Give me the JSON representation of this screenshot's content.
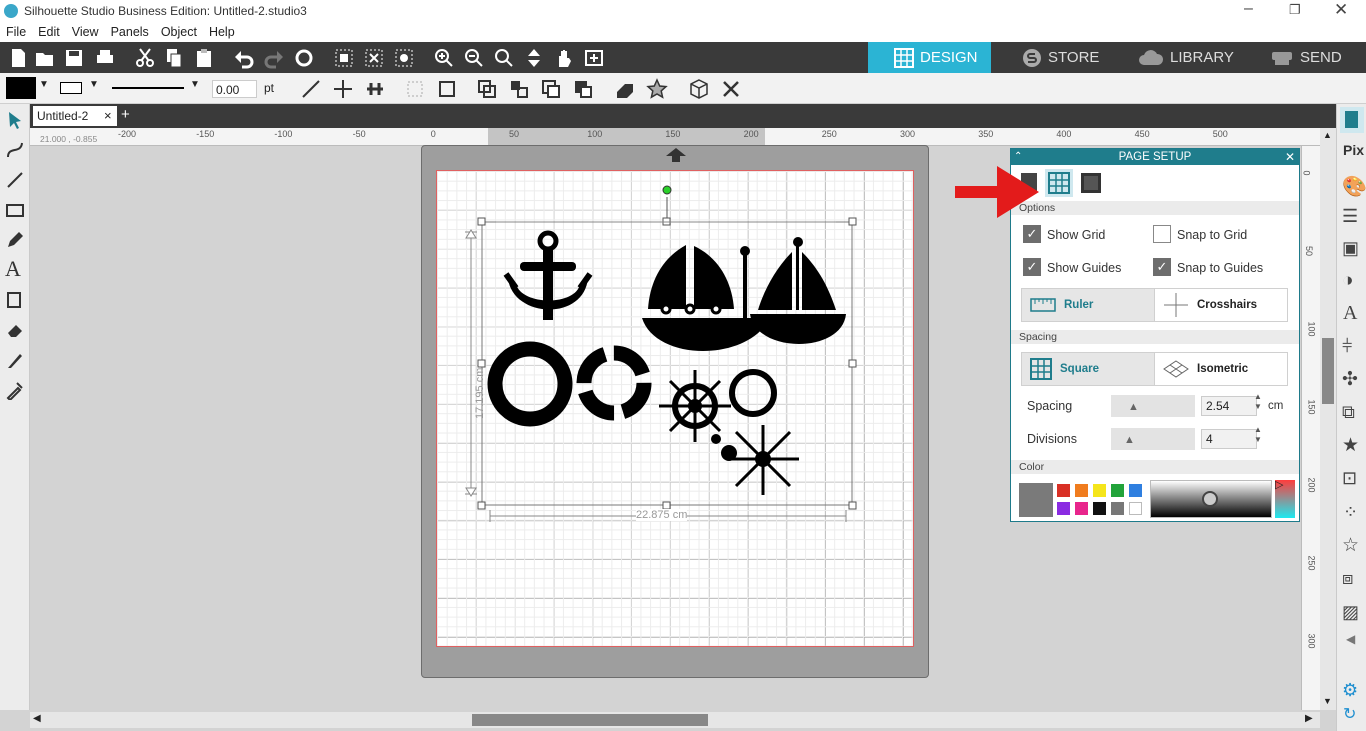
{
  "window": {
    "title": "Silhouette Studio Business Edition: Untitled-2.studio3"
  },
  "menu": [
    "File",
    "Edit",
    "View",
    "Panels",
    "Object",
    "Help"
  ],
  "nav_tabs": [
    {
      "label": "DESIGN"
    },
    {
      "label": "STORE"
    },
    {
      "label": "LIBRARY"
    },
    {
      "label": "SEND"
    }
  ],
  "toolbar2": {
    "line_width": "0.00",
    "unit": "pt"
  },
  "doc_tab": {
    "name": "Untitled-2",
    "close": "×",
    "add": "+"
  },
  "ruler": {
    "coords": "21.000 , -0.855",
    "h_ticks": [
      "-200",
      "-150",
      "-100",
      "-50",
      "0",
      "50",
      "100",
      "150",
      "200",
      "250",
      "300",
      "350",
      "400",
      "450",
      "500"
    ],
    "v_ticks": [
      "0",
      "50",
      "100",
      "150",
      "200",
      "250",
      "300"
    ]
  },
  "canvas": {
    "width_dim": "22.875 cm",
    "height_dim": "17.195 cm"
  },
  "page_setup": {
    "title": "PAGE SETUP",
    "options_label": "Options",
    "show_grid": {
      "label": "Show Grid",
      "checked": true
    },
    "snap_grid": {
      "label": "Snap to Grid",
      "checked": false
    },
    "show_guides": {
      "label": "Show Guides",
      "checked": true
    },
    "snap_guides": {
      "label": "Snap to Guides",
      "checked": true
    },
    "ruler_label": "Ruler",
    "crosshairs_label": "Crosshairs",
    "spacing_section": "Spacing",
    "square_label": "Square",
    "isometric_label": "Isometric",
    "spacing_label": "Spacing",
    "spacing_value": "2.54",
    "spacing_unit": "cm",
    "divisions_label": "Divisions",
    "divisions_value": "4",
    "color_section": "Color",
    "palette": [
      "#d93025",
      "#f07c1e",
      "#f5e51b",
      "#22a33a",
      "#2f7fe0",
      "#8a2be2",
      "#e8258c",
      "#111111",
      "#777777",
      "#ffffff"
    ]
  },
  "colors": {
    "accent": "#2bb4d4",
    "panel_header": "#1f7d8c",
    "arrow": "#e31b1b"
  }
}
